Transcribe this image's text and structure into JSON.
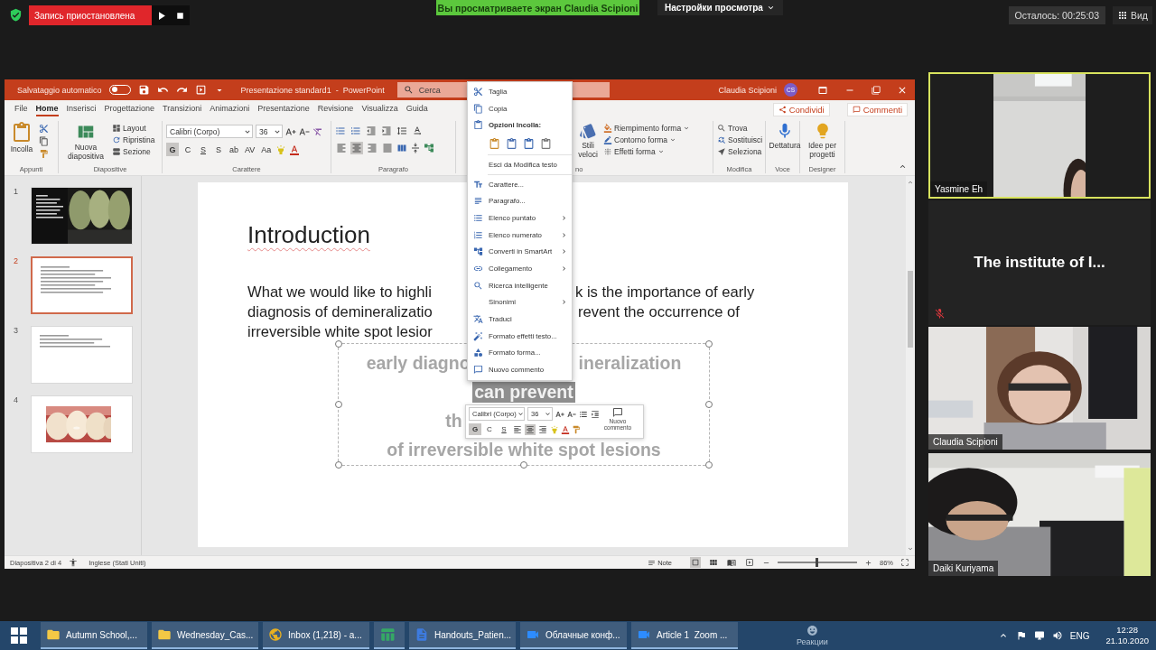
{
  "zoom_top_bar": {
    "recording_status": "Запись приостановлена",
    "sharing_banner": "Вы просматриваете экран Claudia Scipioni",
    "view_options": "Настройки просмотра",
    "time_left": "Осталось: 00:25:03",
    "view_button": "Вид"
  },
  "powerpoint": {
    "title_bar": {
      "autosave_label": "Salvataggio automatico",
      "autosave_on": false,
      "document_title": "Presentazione standard1  -  PowerPoint",
      "search_placeholder": "Cerca",
      "user_name": "Claudia Scipioni",
      "user_initials": "CS"
    },
    "tabs": [
      {
        "label": "File",
        "selected": false
      },
      {
        "label": "Home",
        "selected": true
      },
      {
        "label": "Inserisci",
        "selected": false
      },
      {
        "label": "Progettazione",
        "selected": false
      },
      {
        "label": "Transizioni",
        "selected": false
      },
      {
        "label": "Animazioni",
        "selected": false
      },
      {
        "label": "Presentazione",
        "selected": false
      },
      {
        "label": "Revisione",
        "selected": false
      },
      {
        "label": "Visualizza",
        "selected": false
      },
      {
        "label": "Guida",
        "selected": false
      }
    ],
    "share_button": "Condividi",
    "comments_button": "Commenti",
    "ribbon": {
      "clipboard": {
        "paste": "Incolla",
        "label": "Appunti"
      },
      "slides": {
        "new_slide": "Nuova diapositiva",
        "layout": "Layout",
        "reset": "Ripristina",
        "section": "Sezione",
        "label": "Diapositive"
      },
      "font": {
        "font_name": "Calibri (Corpo)",
        "font_size": "36",
        "format_buttons": [
          {
            "label": "G",
            "selected": true
          },
          {
            "label": "C",
            "selected": false
          },
          {
            "label": "S",
            "selected": false
          },
          {
            "label": "S",
            "selected": false
          },
          {
            "label": "ab",
            "selected": false
          },
          {
            "label": "AV",
            "selected": false
          },
          {
            "label": "Aa",
            "selected": false
          }
        ],
        "label": "Carattere"
      },
      "paragraph": {
        "align_buttons": [
          {
            "selected": false
          },
          {
            "selected": true
          },
          {
            "selected": false
          },
          {
            "selected": false
          }
        ],
        "label": "Paragrafo"
      },
      "drawing": {
        "quick_styles": "Stili veloci",
        "shape_fill": "Riempimento forma",
        "shape_outline": "Contorno forma",
        "shape_effects": "Effetti forma",
        "label": "no"
      },
      "editing": {
        "find": "Trova",
        "replace": "Sostituisci",
        "select": "Seleziona",
        "label": "Modifica"
      },
      "voice": {
        "dictate": "Dettatura",
        "label": "Voce"
      },
      "designer": {
        "design_ideas": "Idee per progetti",
        "label": "Designer"
      }
    },
    "slide_panel": [
      {
        "number": "1",
        "selected": false,
        "kind": "title"
      },
      {
        "number": "2",
        "selected": true,
        "kind": "text"
      },
      {
        "number": "3",
        "selected": false,
        "kind": "text"
      },
      {
        "number": "4",
        "selected": false,
        "kind": "picture"
      }
    ],
    "slide": {
      "title": "Introduction",
      "body_lines": [
        {
          "left": "What we would like to highli",
          "right": "k is the importance of early"
        },
        {
          "left": "diagnosis of demineralizatio",
          "right": "revent the occurrence of"
        },
        {
          "left": "irreversible white spot lesior"
        }
      ],
      "textbox_lines": [
        {
          "left": "early diagno",
          "right": "ineralization",
          "selected": false
        },
        {
          "left": "can prevent",
          "selected": true
        },
        {
          "left": "th",
          "selected": false
        },
        {
          "left": "of irreversible white spot lesions",
          "selected": false
        }
      ]
    },
    "context_menu": [
      {
        "kind": "item",
        "label": "Taglia",
        "submenu": false
      },
      {
        "kind": "item",
        "label": "Copia",
        "submenu": false
      },
      {
        "kind": "header",
        "label": "Opzioni Incolla:"
      },
      {
        "kind": "paste_options"
      },
      {
        "kind": "item",
        "label": "Esci da Modifica testo",
        "submenu": false
      },
      {
        "kind": "item",
        "label": "Carattere...",
        "submenu": false
      },
      {
        "kind": "item",
        "label": "Paragrafo...",
        "submenu": false
      },
      {
        "kind": "item",
        "label": "Elenco puntato",
        "submenu": true
      },
      {
        "kind": "item",
        "label": "Elenco numerato",
        "submenu": true
      },
      {
        "kind": "item",
        "label": "Converti in SmartArt",
        "submenu": true
      },
      {
        "kind": "item",
        "label": "Collegamento",
        "submenu": true
      },
      {
        "kind": "item",
        "label": "Ricerca intelligente",
        "submenu": false
      },
      {
        "kind": "item",
        "label": "Sinonimi",
        "submenu": true
      },
      {
        "kind": "item",
        "label": "Traduci",
        "submenu": false
      },
      {
        "kind": "item",
        "label": "Formato effetti testo...",
        "submenu": false
      },
      {
        "kind": "item",
        "label": "Formato forma...",
        "submenu": false
      },
      {
        "kind": "item",
        "label": "Nuovo commento",
        "submenu": false
      }
    ],
    "mini_toolbar": {
      "font_name": "Calibri (Corpo)",
      "font_size": "36",
      "format_buttons": [
        {
          "label": "G",
          "selected": true
        },
        {
          "label": "C",
          "selected": false
        },
        {
          "label": "S",
          "selected": false
        }
      ],
      "align_buttons": [
        {
          "selected": false
        },
        {
          "selected": true
        },
        {
          "selected": false
        }
      ],
      "new_comment": "Nuovo commento"
    },
    "status_bar": {
      "slide_counter": "Diapositiva 2 di 4",
      "language": "Inglese (Stati Uniti)",
      "notes": "Note",
      "views": [
        {
          "selected": true
        },
        {
          "selected": false
        },
        {
          "selected": false
        },
        {
          "selected": false
        }
      ],
      "zoom": {
        "level": 0.5,
        "reading": "86%"
      }
    }
  },
  "participants": [
    {
      "name": "Yasmine Eh",
      "kind": "video_narrow",
      "speaking": true
    },
    {
      "name": "The institute of I...",
      "kind": "name_only",
      "muted": true
    },
    {
      "name": "Claudia Scipioni",
      "kind": "video",
      "speaking": false
    },
    {
      "name": "Daiki Kuriyama",
      "kind": "video",
      "speaking": false
    }
  ],
  "taskbar": {
    "apps": [
      {
        "label": "Autumn School,...",
        "kind": "folder"
      },
      {
        "label": "Wednesday_Cas...",
        "kind": "folder"
      },
      {
        "label": "Inbox (1,218) - a...",
        "kind": "browser"
      },
      {
        "kind": "spreadsheet"
      },
      {
        "label": "Handouts_Patien...",
        "kind": "document"
      },
      {
        "label": "Облачные конф...",
        "kind": "video"
      },
      {
        "label": "Article 1  Zoom ...",
        "kind": "video"
      }
    ],
    "overlay_label": "Реакции",
    "language": "ENG",
    "time": "12:28",
    "date": "21.10.2020"
  }
}
